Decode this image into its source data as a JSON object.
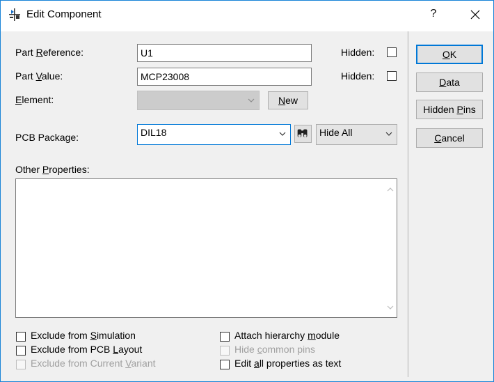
{
  "window": {
    "title": "Edit Component",
    "help_glyph": "?",
    "close_glyph": "✕"
  },
  "form": {
    "part_reference": {
      "label_pre": "Part ",
      "label_u": "R",
      "label_post": "eference:",
      "value": "U1",
      "hidden_label": "Hidden:",
      "hidden_checked": false
    },
    "part_value": {
      "label_pre": "Part ",
      "label_u": "V",
      "label_post": "alue:",
      "value": "MCP23008",
      "hidden_label": "Hidden:",
      "hidden_checked": false
    },
    "element": {
      "label_pre": "",
      "label_u": "E",
      "label_post": "lement:",
      "value": "",
      "new_button_u": "N",
      "new_button_post": "ew"
    },
    "pcb_package": {
      "label": "PCB Package:",
      "value": "DIL18",
      "hide_select_value": "Hide All"
    },
    "other_properties": {
      "label_pre": "Other ",
      "label_u": "P",
      "label_post": "roperties:",
      "value": ""
    }
  },
  "options": {
    "exclude_simulation": {
      "pre": "Exclude from ",
      "u": "S",
      "post": "imulation",
      "checked": false,
      "enabled": true
    },
    "exclude_pcb": {
      "pre": "Exclude from PCB ",
      "u": "L",
      "post": "ayout",
      "checked": false,
      "enabled": true
    },
    "exclude_variant": {
      "pre": "Exclude from Current ",
      "u": "V",
      "post": "ariant",
      "checked": false,
      "enabled": false
    },
    "attach_hierarchy": {
      "pre": "Attach hierarchy ",
      "u": "m",
      "post": "odule",
      "checked": false,
      "enabled": true
    },
    "hide_common_pins": {
      "pre": "Hide ",
      "u": "c",
      "post": "ommon pins",
      "checked": false,
      "enabled": false
    },
    "edit_as_text": {
      "pre": "Edit ",
      "u": "a",
      "post": "ll properties as text",
      "checked": false,
      "enabled": true
    }
  },
  "side_buttons": {
    "ok": {
      "u": "O",
      "post": "K"
    },
    "data": {
      "u": "D",
      "post": "ata"
    },
    "hidden_pins": {
      "pre": "Hidden ",
      "u": "P",
      "post": "ins"
    },
    "cancel": {
      "u": "C",
      "post": "ancel"
    }
  }
}
